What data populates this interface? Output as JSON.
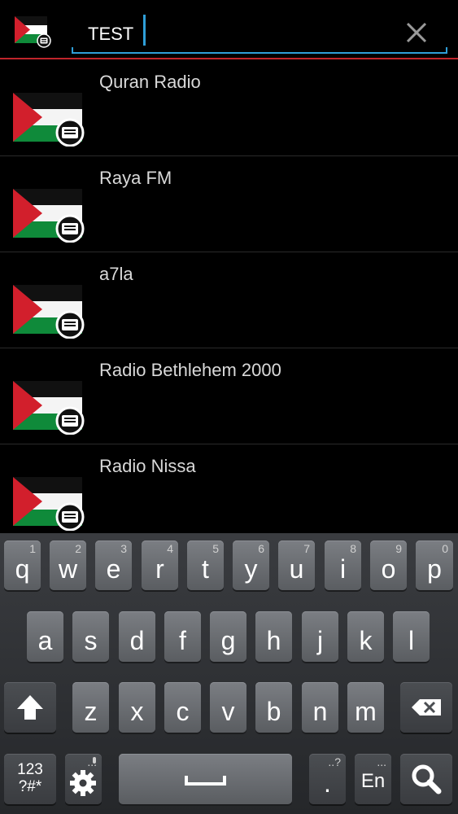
{
  "search": {
    "value": "TEST",
    "clear_icon": "close-icon"
  },
  "app_icon": "palestine-flag-radio-icon",
  "stations": [
    {
      "name": "Quran Radio"
    },
    {
      "name": "Raya FM"
    },
    {
      "name": "a7la"
    },
    {
      "name": "Radio Bethlehem 2000"
    },
    {
      "name": "Radio Nissa"
    }
  ],
  "keyboard": {
    "row1": [
      {
        "key": "q",
        "hint": "1"
      },
      {
        "key": "w",
        "hint": "2"
      },
      {
        "key": "e",
        "hint": "3"
      },
      {
        "key": "r",
        "hint": "4"
      },
      {
        "key": "t",
        "hint": "5"
      },
      {
        "key": "y",
        "hint": "6"
      },
      {
        "key": "u",
        "hint": "7"
      },
      {
        "key": "i",
        "hint": "8"
      },
      {
        "key": "o",
        "hint": "9"
      },
      {
        "key": "p",
        "hint": "0"
      }
    ],
    "row2": [
      "a",
      "s",
      "d",
      "f",
      "g",
      "h",
      "j",
      "k",
      "l"
    ],
    "row3": [
      "z",
      "x",
      "c",
      "v",
      "b",
      "n",
      "m"
    ],
    "symbols_label": "123\n?#*",
    "symbols_top": "123",
    "symbols_bottom": "?#*",
    "period": ".",
    "period_hint": "..?",
    "lang": "En",
    "lang_hint": "...",
    "settings_hint": "..."
  },
  "colors": {
    "accent": "#2f9fd8",
    "divider": "#c0242b",
    "flag_red": "#d21f2c",
    "flag_green": "#0f8a3a"
  }
}
